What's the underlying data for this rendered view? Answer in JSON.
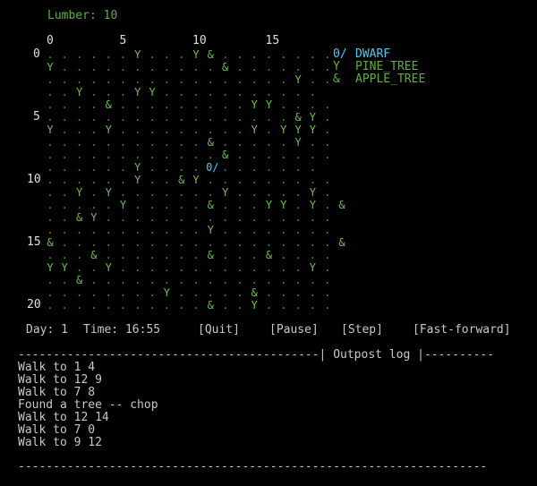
{
  "lumber": "Lumber: 10",
  "col_ticks": [
    "0",
    "5",
    "10",
    "15"
  ],
  "row_ticks": [
    "0",
    "5",
    "10",
    "15",
    "20"
  ],
  "map_rows": [
    "......Y...Y&........",
    "Y...........&.......",
    ".................Y..",
    "..Y...YY...........",
    "....&.........YY....",
    ".................&Y.",
    "Y...Y.........Y.YYY.",
    "...........&.....Y..",
    "............&.......",
    "......Y....0/.......",
    "......Y..&Y.........",
    "..Y.Y.......Y.....Y.",
    ".....Y.....&...YY.Y.&",
    "..&Y................",
    "...........Y........",
    "&...................&",
    "...&.......&...&....",
    "YY..Y.............Y.",
    "..&.................",
    "........Y.....&.....",
    "...........&..Y....."
  ],
  "legend": [
    {
      "glyph": "0/",
      "label": "DWARF",
      "kind": "dwarf"
    },
    {
      "glyph": "Y",
      "label": "PINE_TREE",
      "kind": "pine"
    },
    {
      "glyph": "&",
      "label": "APPLE_TREE",
      "kind": "apple"
    }
  ],
  "status": {
    "day": "Day: 1",
    "time": "Time: 16:55",
    "quit": "[Quit]",
    "pause": "[Pause]",
    "step": "[Step]",
    "ff": "[Fast-forward]"
  },
  "log": {
    "header": "-------------------------------------------| Outpost log |----------",
    "footer": "-------------------------------------------------------------------",
    "lines": [
      "Walk to 1 4",
      "Walk to 12 9",
      "Walk to 7 8",
      "Found a tree -- chop",
      "Walk to 12 14",
      "Walk to 7 0",
      "Walk to 9 12"
    ]
  },
  "colors": {
    "green": "#5faf3f",
    "cyan": "#4fc8f0",
    "background": "#000000"
  }
}
